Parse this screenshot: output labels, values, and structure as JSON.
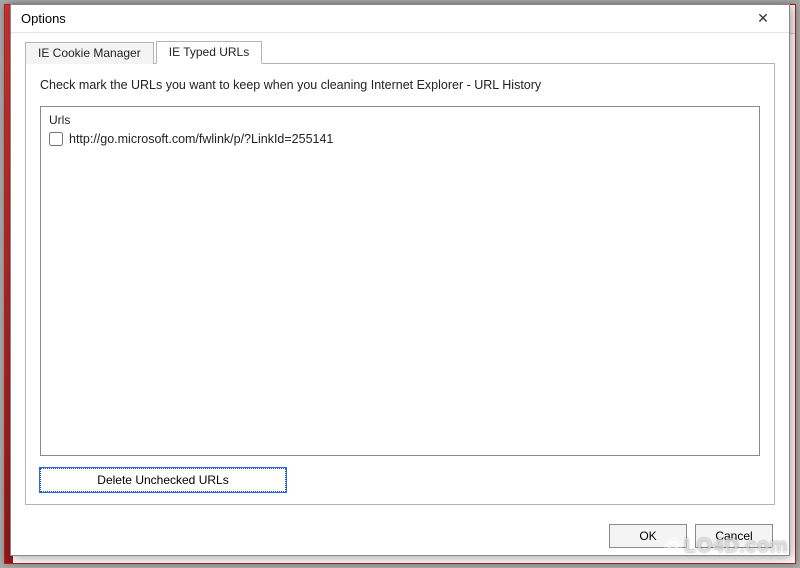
{
  "window": {
    "title": "Options"
  },
  "tabs": [
    {
      "label": "IE Cookie Manager",
      "active": false
    },
    {
      "label": "IE Typed URLs",
      "active": true
    }
  ],
  "page": {
    "instruction": "Check mark the URLs you want to keep when you cleaning Internet Explorer - URL History",
    "list_header": "Urls",
    "urls": [
      {
        "checked": false,
        "text": "http://go.microsoft.com/fwlink/p/?LinkId=255141"
      }
    ],
    "delete_label": "Delete Unchecked URLs"
  },
  "footer": {
    "ok_label": "OK",
    "cancel_label": "Cancel"
  },
  "watermark": "LO4D.com"
}
